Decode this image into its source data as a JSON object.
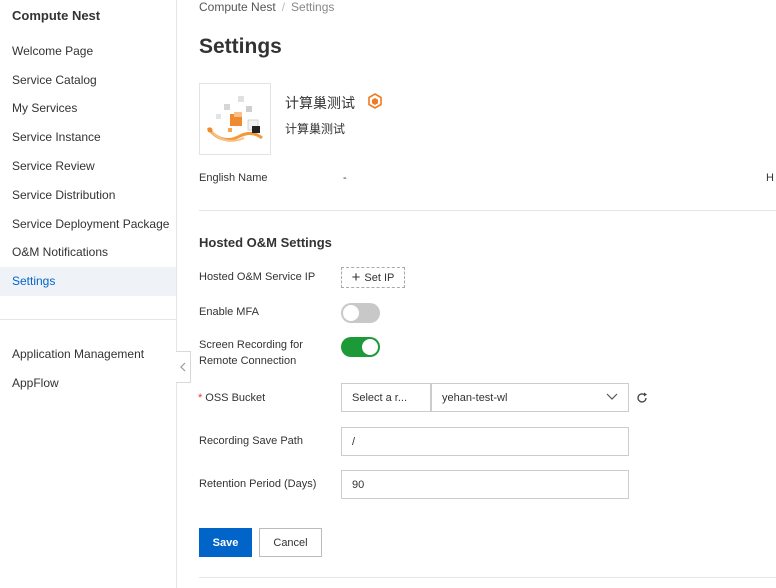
{
  "sidebar": {
    "product_title": "Compute Nest",
    "items": [
      {
        "label": "Welcome Page"
      },
      {
        "label": "Service Catalog"
      },
      {
        "label": "My Services"
      },
      {
        "label": "Service Instance"
      },
      {
        "label": "Service Review"
      },
      {
        "label": "Service Distribution"
      },
      {
        "label": "Service Deployment Package"
      },
      {
        "label": "O&M Notifications"
      },
      {
        "label": "Settings",
        "active": true
      }
    ],
    "bottom_items": [
      {
        "label": "Application Management"
      },
      {
        "label": "AppFlow"
      }
    ],
    "collapse_icon": "chevron-left-icon"
  },
  "breadcrumb": {
    "root": "Compute Nest",
    "separator": "/",
    "current": "Settings"
  },
  "page": {
    "title": "Settings"
  },
  "service": {
    "name": "计算巢测试",
    "description": "计算巢测试",
    "badge_icon": "hexagon-badge-icon",
    "badge_color": "#f07a20"
  },
  "info": {
    "english_name_label": "English Name",
    "english_name_value": "-",
    "cut_off_label": "H"
  },
  "om_settings": {
    "section_title": "Hosted O&M Settings",
    "service_ip_label": "Hosted O&M Service IP",
    "set_ip_button": "Set IP",
    "enable_mfa_label": "Enable MFA",
    "enable_mfa": false,
    "screen_recording_label_line1": "Screen Recording for",
    "screen_recording_label_line2": "Remote Connection",
    "screen_recording": true,
    "oss_bucket_label": "OSS Bucket",
    "oss_bucket_required_mark": "*",
    "region_select_placeholder": "Select a r...",
    "bucket_select_value": "yehan-test-wl",
    "recording_path_label": "Recording Save Path",
    "recording_path_value": "/",
    "retention_label": "Retention Period (Days)",
    "retention_value": "90"
  },
  "actions": {
    "save": "Save",
    "cancel": "Cancel"
  },
  "colors": {
    "primary": "#0064c8",
    "switch_on": "#1b9a37",
    "switch_off": "#c8c8c8",
    "required": "#e53935",
    "active_nav_bg": "#eff3f8"
  }
}
